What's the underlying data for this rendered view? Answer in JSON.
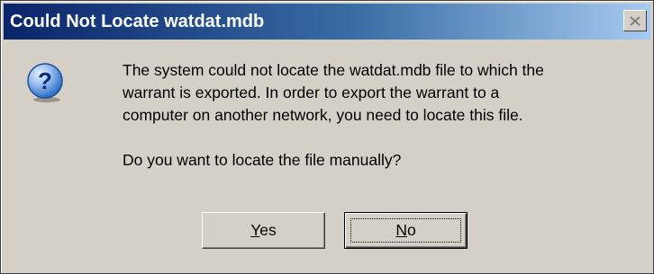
{
  "window": {
    "title": "Could Not Locate watdat.mdb",
    "close_icon": "close-icon"
  },
  "content": {
    "icon": "question-icon",
    "message_lines": [
      "The system could not locate the watdat.mdb file to which the",
      "warrant is exported.  In order to export the warrant to a",
      "computer on another network, you need to locate this file."
    ],
    "question": "Do you want to locate the file manually?"
  },
  "buttons": {
    "yes": {
      "mnemonic": "Y",
      "rest": "es"
    },
    "no": {
      "mnemonic": "N",
      "rest": "o"
    }
  },
  "colors": {
    "title_gradient_start": "#0a246a",
    "title_gradient_end": "#a6caf0",
    "dialog_face": "#d4d0c8",
    "icon_blue": "#2f6fc4"
  }
}
